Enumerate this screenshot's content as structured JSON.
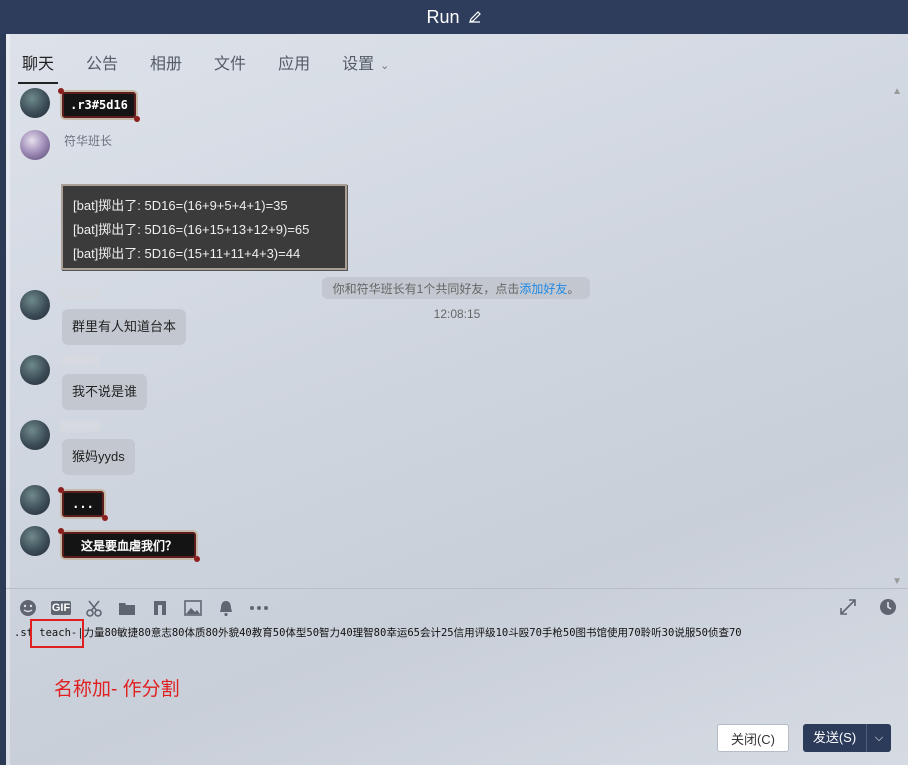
{
  "window": {
    "title": "Run"
  },
  "tabs": [
    {
      "label": "聊天"
    },
    {
      "label": "公告"
    },
    {
      "label": "相册"
    },
    {
      "label": "文件"
    },
    {
      "label": "应用"
    },
    {
      "label": "设置"
    }
  ],
  "messages": {
    "sticker1": ".r3#5d16",
    "fuhua_name": "符华班长",
    "dice_lines": [
      "[bat]掷出了: 5D16=(16+9+5+4+1)=35",
      "[bat]掷出了: 5D16=(16+15+13+12+9)=65",
      "[bat]掷出了: 5D16=(15+11+11+4+3)=44"
    ],
    "system_text": "你和符华班长有1个共同好友，点击",
    "system_link": "添加好友",
    "system_end": "。",
    "timestamp": "12:08:15",
    "bubble1": "群里有人知道台本",
    "bubble2": "我不说是谁",
    "bubble3": "猴妈yyds",
    "sticker2": "...",
    "sticker3": "这是要血虐我们？"
  },
  "input": {
    "text": ".st teach-|力量80敏捷80意志80体质80外貌40教育50体型50智力40理智80幸运65会计25信用评级10斗殴70手枪50图书馆使用70聆听30说服50侦查70"
  },
  "annotation": {
    "note": "名称加- 作分割"
  },
  "buttons": {
    "close": "关闭(C)",
    "send": "发送(S)"
  },
  "toolbar_icons": [
    "emoji-icon",
    "gif-icon",
    "scissors-icon",
    "folder-icon",
    "music-icon",
    "image-icon",
    "bell-icon",
    "more-icon"
  ],
  "toolbar_right_icons": [
    "expand-icon",
    "history-icon"
  ]
}
